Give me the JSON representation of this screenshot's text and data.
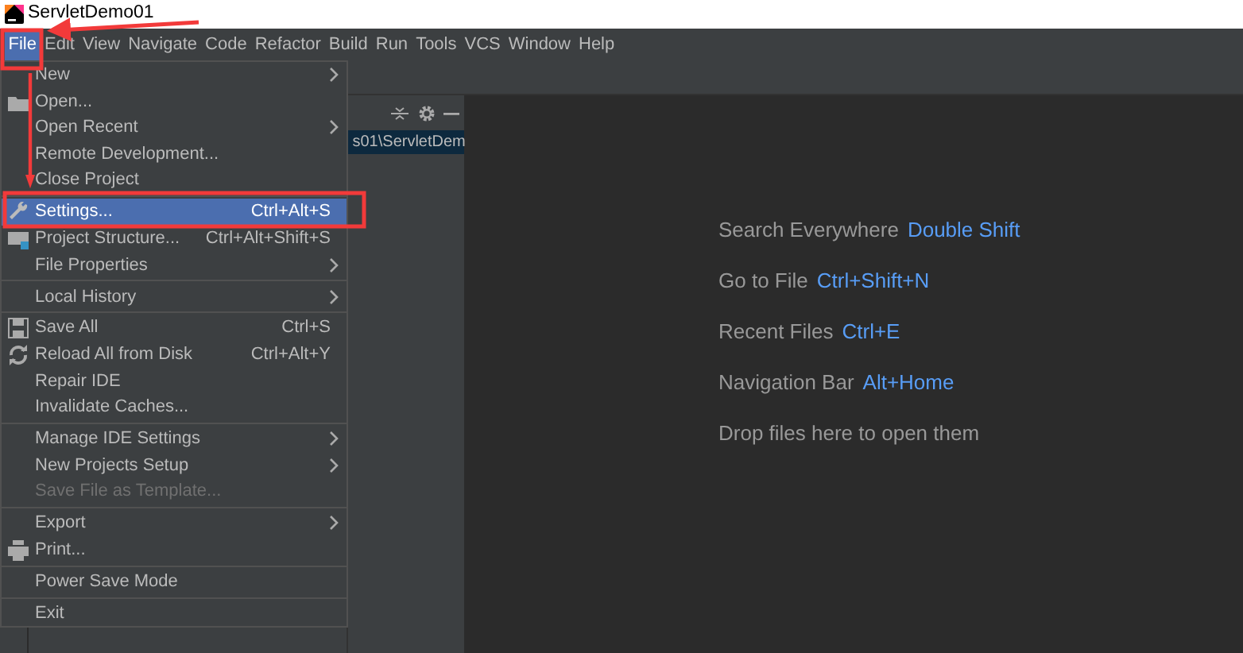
{
  "window": {
    "title": "ServletDemo01"
  },
  "menubar": [
    {
      "label": "File",
      "selected": true
    },
    {
      "label": "Edit",
      "selected": false
    },
    {
      "label": "View",
      "selected": false
    },
    {
      "label": "Navigate",
      "selected": false
    },
    {
      "label": "Code",
      "selected": false
    },
    {
      "label": "Refactor",
      "selected": false
    },
    {
      "label": "Build",
      "selected": false
    },
    {
      "label": "Run",
      "selected": false
    },
    {
      "label": "Tools",
      "selected": false
    },
    {
      "label": "VCS",
      "selected": false
    },
    {
      "label": "Window",
      "selected": false
    },
    {
      "label": "Help",
      "selected": false
    }
  ],
  "file_menu": {
    "groups": [
      [
        {
          "label": "New",
          "submenu": true,
          "selected": false,
          "disabled": false
        },
        {
          "label": "Open...",
          "submenu": false,
          "selected": false,
          "disabled": false
        },
        {
          "label": "Open Recent",
          "submenu": true,
          "selected": false,
          "disabled": false
        },
        {
          "label": "Remote Development...",
          "submenu": false,
          "selected": false,
          "disabled": false
        },
        {
          "label": "Close Project",
          "submenu": false,
          "selected": false,
          "disabled": false
        }
      ],
      [
        {
          "label": "Settings...",
          "shortcut": "Ctrl+Alt+S",
          "submenu": false,
          "selected": true,
          "disabled": false
        },
        {
          "label": "Project Structure...",
          "shortcut": "Ctrl+Alt+Shift+S",
          "submenu": false,
          "selected": false,
          "disabled": false
        },
        {
          "label": "File Properties",
          "submenu": true,
          "selected": false,
          "disabled": false
        }
      ],
      [
        {
          "label": "Local History",
          "submenu": true,
          "selected": false,
          "disabled": false
        }
      ],
      [
        {
          "label": "Save All",
          "shortcut": "Ctrl+S",
          "submenu": false,
          "selected": false,
          "disabled": false
        },
        {
          "label": "Reload All from Disk",
          "shortcut": "Ctrl+Alt+Y",
          "submenu": false,
          "selected": false,
          "disabled": false
        },
        {
          "label": "Repair IDE",
          "submenu": false,
          "selected": false,
          "disabled": false
        },
        {
          "label": "Invalidate Caches...",
          "submenu": false,
          "selected": false,
          "disabled": false
        }
      ],
      [
        {
          "label": "Manage IDE Settings",
          "submenu": true,
          "selected": false,
          "disabled": false
        },
        {
          "label": "New Projects Setup",
          "submenu": true,
          "selected": false,
          "disabled": false
        },
        {
          "label": "Save File as Template...",
          "submenu": false,
          "selected": false,
          "disabled": true
        }
      ],
      [
        {
          "label": "Export",
          "submenu": true,
          "selected": false,
          "disabled": false
        },
        {
          "label": "Print...",
          "submenu": false,
          "selected": false,
          "disabled": false
        }
      ],
      [
        {
          "label": "Power Save Mode",
          "submenu": false,
          "selected": false,
          "disabled": false
        }
      ],
      [
        {
          "label": "Exit",
          "submenu": false,
          "selected": false,
          "disabled": false
        }
      ]
    ]
  },
  "project_panel": {
    "path": "s01\\ServletDem"
  },
  "welcome_hints": [
    {
      "label": "Search Everywhere",
      "shortcut": "Double Shift"
    },
    {
      "label": "Go to File",
      "shortcut": "Ctrl+Shift+N"
    },
    {
      "label": "Recent Files",
      "shortcut": "Ctrl+E"
    },
    {
      "label": "Navigation Bar",
      "shortcut": "Alt+Home"
    },
    {
      "label": "Drop files here to open them"
    }
  ]
}
